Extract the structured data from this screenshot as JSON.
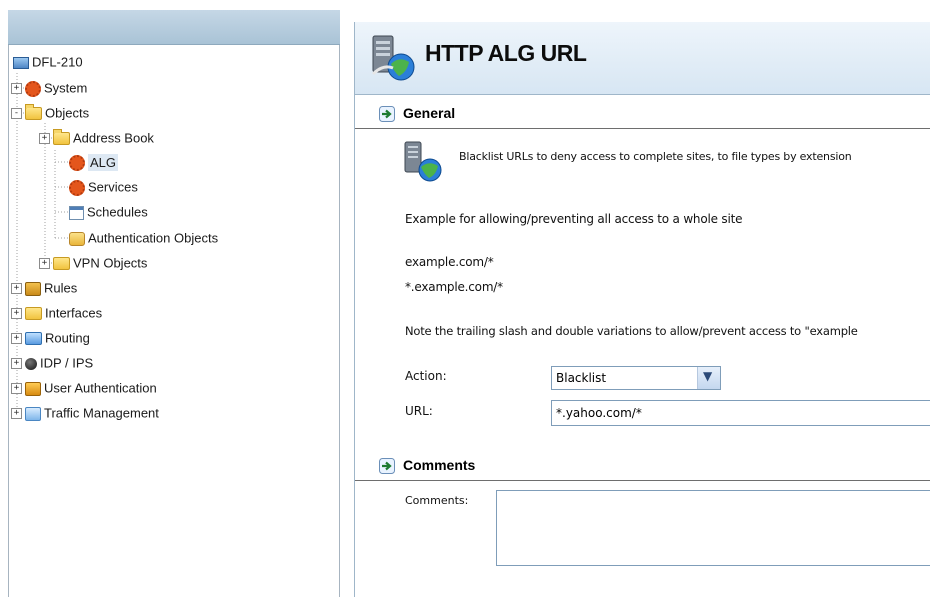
{
  "tree": {
    "root": "DFL-210",
    "items": [
      {
        "label": "System",
        "expander": "+",
        "icon": "gear-icon"
      },
      {
        "label": "Objects",
        "expander": "-",
        "icon": "folder-icon"
      },
      {
        "label": "Address Book",
        "expander": "+",
        "icon": "folder-icon"
      },
      {
        "label": "ALG",
        "expander": "",
        "icon": "gear-icon",
        "selected": true
      },
      {
        "label": "Services",
        "expander": "",
        "icon": "gear-icon"
      },
      {
        "label": "Schedules",
        "expander": "",
        "icon": "calendar-icon"
      },
      {
        "label": "Authentication Objects",
        "expander": "",
        "icon": "auth-icon"
      },
      {
        "label": "VPN Objects",
        "expander": "+",
        "icon": "folder-icon"
      },
      {
        "label": "Rules",
        "expander": "+",
        "icon": "rules-icon"
      },
      {
        "label": "Interfaces",
        "expander": "+",
        "icon": "folder-icon"
      },
      {
        "label": "Routing",
        "expander": "+",
        "icon": "routing-icon"
      },
      {
        "label": "IDP / IPS",
        "expander": "+",
        "icon": "idp-icon"
      },
      {
        "label": "User Authentication",
        "expander": "+",
        "icon": "user-auth-icon"
      },
      {
        "label": "Traffic Management",
        "expander": "+",
        "icon": "traffic-icon"
      }
    ]
  },
  "page": {
    "title": "HTTP ALG URL"
  },
  "general": {
    "heading": "General",
    "description": "Blacklist URLs to deny access to complete sites, to file types by extension",
    "example_intro": "Example for allowing/preventing all access to a whole site",
    "example_1": "example.com/*",
    "example_2": "*.example.com/*",
    "note": "Note the trailing slash and double variations to allow/prevent access to \"example",
    "action_label": "Action:",
    "action_value": "Blacklist",
    "url_label": "URL:",
    "url_value": "*.yahoo.com/*"
  },
  "comments": {
    "heading": "Comments",
    "label": "Comments:",
    "value": ""
  },
  "colors": {
    "title_bar": "#d7e6f3",
    "selected_row": "#dde8f3",
    "input_border": "#7f9db9"
  }
}
